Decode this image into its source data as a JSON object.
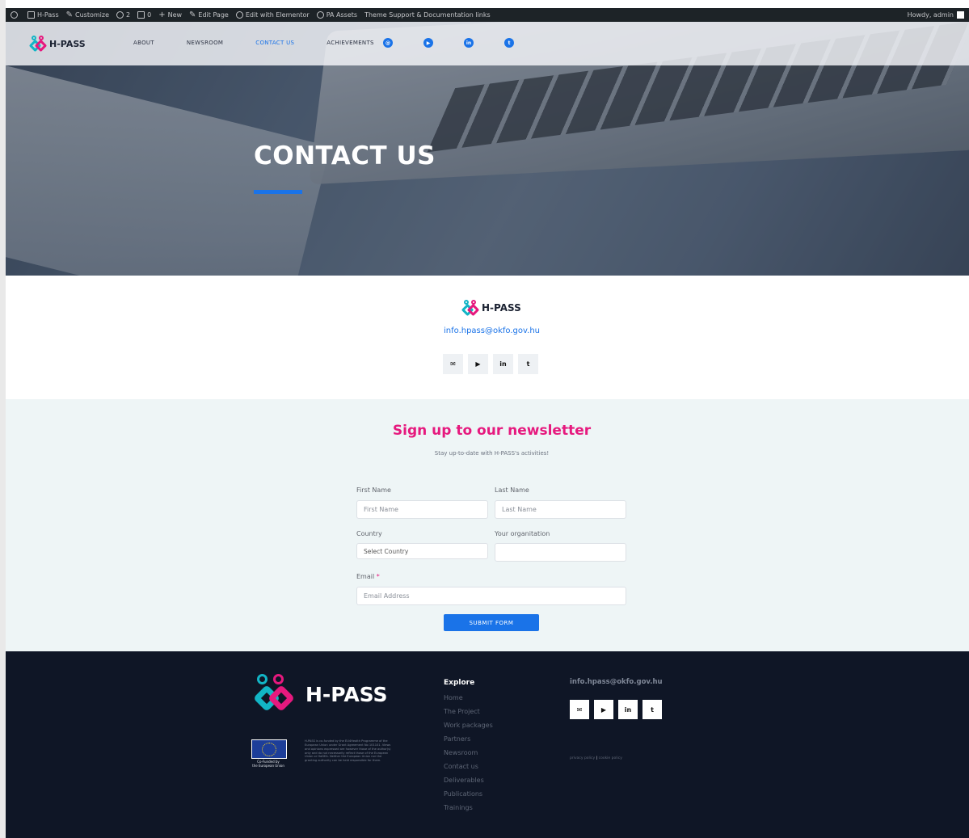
{
  "adminbar": {
    "items": [
      "H-Pass",
      "Customize",
      "2",
      "0",
      "New",
      "Edit Page",
      "Edit with Elementor",
      "PA Assets",
      "Theme Support & Documentation links"
    ],
    "howdy": "Howdy, admin"
  },
  "nav": {
    "logo_text": "H-PASS",
    "links": [
      "ABOUT",
      "NEWSROOM",
      "CONTACT US",
      "ACHIEVEMENTS"
    ],
    "social_icons": [
      "email-icon",
      "youtube-icon",
      "linkedin-icon",
      "twitter-icon"
    ]
  },
  "hero": {
    "title": "CONTACT US"
  },
  "contact": {
    "logo_text": "H-PASS",
    "email": "info.hpass@okfo.gov.hu",
    "social_icons": [
      "email-icon",
      "youtube-icon",
      "linkedin-icon",
      "twitter-icon"
    ]
  },
  "newsletter": {
    "title": "Sign up to our newsletter",
    "subtitle": "Stay up-to-date with H-PASS's activities!",
    "first_name_label": "First Name",
    "first_name_placeholder": "First Name",
    "last_name_label": "Last Name",
    "last_name_placeholder": "Last Name",
    "country_label": "Country",
    "country_value": "Select Country",
    "org_label": "Your organitation",
    "email_label": "Email",
    "email_required": "*",
    "email_placeholder": "Email Address",
    "submit_label": "SUBMIT FORM"
  },
  "footer": {
    "logo_text": "H-PASS",
    "eu_caption_line1": "Co-Funded by",
    "eu_caption_line2": "the European Union",
    "eu_text": "H-PASS is co-funded by the EU4Health Programme of the European Union under Grant Agreement No 101101. Views and opinions expressed are however those of the author(s) only and do not necessarily reflect those of the European Union or HaDEA. Neither the European Union nor the granting authority can be held responsible for them.",
    "explore_title": "Explore",
    "explore_links": [
      "Home",
      "The Project",
      "Work packages",
      "Partners",
      "Newsroom",
      "Contact us",
      "Deliverables",
      "Publications",
      "Trainings"
    ],
    "email": "info.hpass@okfo.gov.hu",
    "privacy": "privacy policy",
    "cookie": "cookie policy"
  }
}
